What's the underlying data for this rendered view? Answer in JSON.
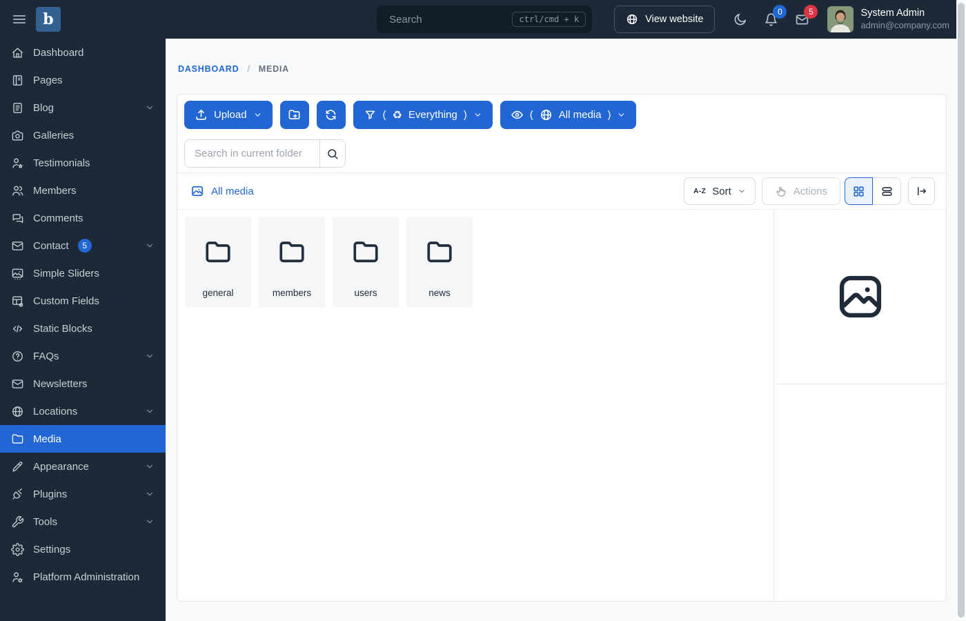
{
  "topbar": {
    "search_placeholder": "Search",
    "search_shortcut": "ctrl/cmd + k",
    "view_website_label": "View website",
    "notifications_count": "0",
    "messages_count": "5",
    "user_name": "System Admin",
    "user_email": "admin@company.com"
  },
  "sidebar": {
    "items": [
      {
        "label": "Dashboard",
        "icon": "home"
      },
      {
        "label": "Pages",
        "icon": "pages"
      },
      {
        "label": "Blog",
        "icon": "blog",
        "chevron": true
      },
      {
        "label": "Galleries",
        "icon": "camera"
      },
      {
        "label": "Testimonials",
        "icon": "user-star"
      },
      {
        "label": "Members",
        "icon": "users"
      },
      {
        "label": "Comments",
        "icon": "comments"
      },
      {
        "label": "Contact",
        "icon": "mail",
        "badge": "5",
        "chevron": true
      },
      {
        "label": "Simple Sliders",
        "icon": "slideshow"
      },
      {
        "label": "Custom Fields",
        "icon": "table-gear"
      },
      {
        "label": "Static Blocks",
        "icon": "code"
      },
      {
        "label": "FAQs",
        "icon": "help",
        "chevron": true
      },
      {
        "label": "Newsletters",
        "icon": "mail"
      },
      {
        "label": "Locations",
        "icon": "globe",
        "chevron": true
      },
      {
        "label": "Media",
        "icon": "folder",
        "active": true
      },
      {
        "label": "Appearance",
        "icon": "brush",
        "chevron": true
      },
      {
        "label": "Plugins",
        "icon": "plug",
        "chevron": true
      },
      {
        "label": "Tools",
        "icon": "wrench",
        "chevron": true
      },
      {
        "label": "Settings",
        "icon": "gear"
      },
      {
        "label": "Platform Administration",
        "icon": "user-cog"
      }
    ]
  },
  "breadcrumb": {
    "home": "DASHBOARD",
    "separator": "/",
    "current": "MEDIA"
  },
  "toolbar": {
    "upload_label": "Upload",
    "filter": {
      "open": "(",
      "label": "Everything",
      "close": ")"
    },
    "visibility": {
      "open": "(",
      "label": "All media",
      "close": ")"
    },
    "search_placeholder": "Search in current folder"
  },
  "listbar": {
    "location_label": "All media",
    "sort_prefix": "A-Z",
    "sort_label": "Sort",
    "actions_label": "Actions"
  },
  "folders": [
    {
      "name": "general"
    },
    {
      "name": "members"
    },
    {
      "name": "users"
    },
    {
      "name": "news"
    }
  ],
  "colors": {
    "accent_blue": "#2166d3",
    "navy": "#1d2936",
    "badge_red": "#dc3545",
    "badge_blue": "#2166d3",
    "page_bg": "#f8f9fb"
  }
}
